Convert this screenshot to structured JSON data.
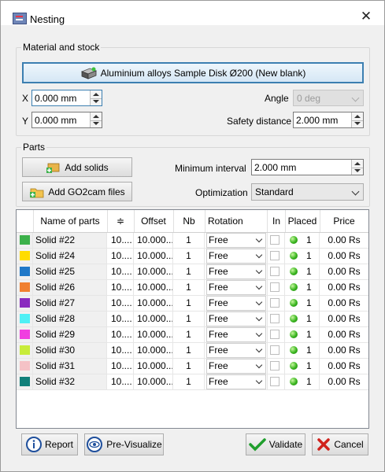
{
  "window": {
    "title": "Nesting",
    "close_glyph": "✕",
    "title_icon": "nesting-app-icon"
  },
  "material": {
    "group_title": "Material and stock",
    "stock_button": "Aluminium alloys Sample Disk Ø200 (New blank)",
    "x_label": "X",
    "x_value": "0.000 mm",
    "y_label": "Y",
    "y_value": "0.000 mm",
    "angle_label": "Angle",
    "angle_value": "0 deg",
    "safety_label": "Safety distance",
    "safety_value": "2.000 mm"
  },
  "parts": {
    "group_title": "Parts",
    "add_solids": "Add solids",
    "add_files": "Add GO2cam files",
    "min_interval_label": "Minimum interval",
    "min_interval_value": "2.000 mm",
    "optimization_label": "Optimization",
    "optimization_value": "Standard"
  },
  "table": {
    "headers": {
      "name": "Name of parts",
      "spacing": "≑",
      "offset": "Offset",
      "nb": "Nb",
      "rotation": "Rotation",
      "in": "In",
      "placed": "Placed",
      "price": "Price"
    },
    "rows": [
      {
        "color": "#3cb14a",
        "name": "Solid #22",
        "spacing": "10....",
        "offset": "10.000...",
        "nb": "1",
        "rotation": "Free",
        "placed": "1",
        "price": "0.00 Rs"
      },
      {
        "color": "#ffdc00",
        "name": "Solid #24",
        "spacing": "10....",
        "offset": "10.000...",
        "nb": "1",
        "rotation": "Free",
        "placed": "1",
        "price": "0.00 Rs"
      },
      {
        "color": "#1f78c8",
        "name": "Solid #25",
        "spacing": "10....",
        "offset": "10.000...",
        "nb": "1",
        "rotation": "Free",
        "placed": "1",
        "price": "0.00 Rs"
      },
      {
        "color": "#f08030",
        "name": "Solid #26",
        "spacing": "10....",
        "offset": "10.000...",
        "nb": "1",
        "rotation": "Free",
        "placed": "1",
        "price": "0.00 Rs"
      },
      {
        "color": "#8a2bbf",
        "name": "Solid #27",
        "spacing": "10....",
        "offset": "10.000...",
        "nb": "1",
        "rotation": "Free",
        "placed": "1",
        "price": "0.00 Rs"
      },
      {
        "color": "#4ff0f5",
        "name": "Solid #28",
        "spacing": "10....",
        "offset": "10.000...",
        "nb": "1",
        "rotation": "Free",
        "placed": "1",
        "price": "0.00 Rs"
      },
      {
        "color": "#f03ee0",
        "name": "Solid #29",
        "spacing": "10....",
        "offset": "10.000...",
        "nb": "1",
        "rotation": "Free",
        "placed": "1",
        "price": "0.00 Rs"
      },
      {
        "color": "#c8ec3a",
        "name": "Solid #30",
        "spacing": "10....",
        "offset": "10.000...",
        "nb": "1",
        "rotation": "Free",
        "placed": "1",
        "price": "0.00 Rs"
      },
      {
        "color": "#f5c2c6",
        "name": "Solid #31",
        "spacing": "10....",
        "offset": "10.000...",
        "nb": "1",
        "rotation": "Free",
        "placed": "1",
        "price": "0.00 Rs"
      },
      {
        "color": "#10807a",
        "name": "Solid #32",
        "spacing": "10....",
        "offset": "10.000...",
        "nb": "1",
        "rotation": "Free",
        "placed": "1",
        "price": "0.00 Rs"
      }
    ]
  },
  "footer": {
    "report": "Report",
    "previsualize": "Pre-Visualize",
    "validate": "Validate",
    "cancel": "Cancel"
  }
}
